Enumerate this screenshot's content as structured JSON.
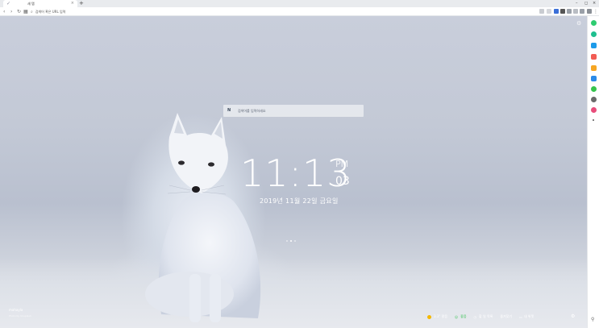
{
  "browser": {
    "tab_title": "새 탭",
    "tab_close": "×",
    "new_tab": "+",
    "window_controls": [
      "–",
      "◻",
      "×"
    ],
    "address_placeholder": "검색어 혹은 URL 입력",
    "nav": [
      "‹",
      "›",
      "↻",
      "▦"
    ]
  },
  "main": {
    "search_logo": "N",
    "search_placeholder": "검색어를 입력하세요",
    "clock": {
      "hours_minutes": "11:13",
      "ampm": "PM",
      "seconds": "03"
    },
    "date": "2019년 11월 22일 금요일",
    "credit": {
      "name": "mahayla",
      "by": "Photo by Unsplash"
    },
    "bottom": {
      "weather": "3.3° 맑음",
      "status": "좋음",
      "shortcut1": "할 일 목록",
      "shortcut2": "즐겨찾기",
      "shortcut3": "내 위젯"
    }
  },
  "sidebar": {
    "colors": [
      "#2ecc71",
      "#1fbf8f",
      "#1e9be9",
      "#f25c54",
      "#f6a623",
      "#2b8ae8",
      "#35c44d",
      "#6a6a6a",
      "#e84d7b"
    ]
  }
}
